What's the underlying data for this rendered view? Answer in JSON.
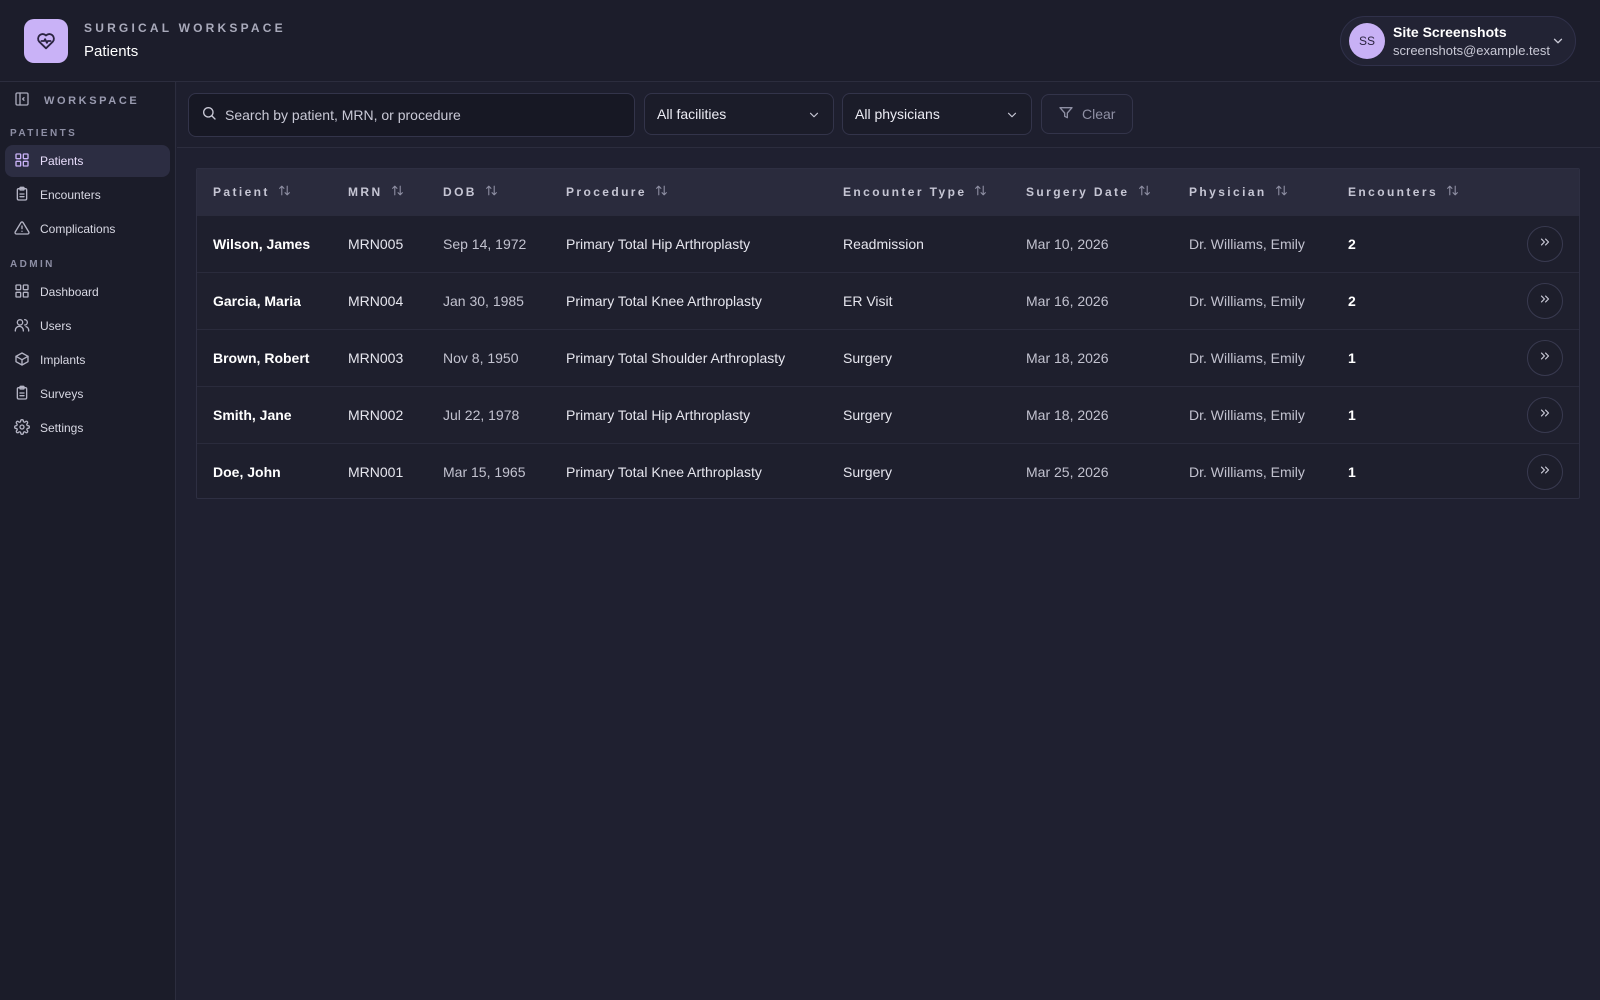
{
  "header": {
    "kicker": "SURGICAL WORKSPACE",
    "title": "Patients"
  },
  "user": {
    "initials": "SS",
    "name": "Site Screenshots",
    "email": "screenshots@example.test"
  },
  "sidebar": {
    "workspace_label": "WORKSPACE",
    "sections": [
      {
        "label": "PATIENTS",
        "items": [
          {
            "label": "Patients",
            "icon": "grid-icon",
            "active": true
          },
          {
            "label": "Encounters",
            "icon": "clipboard-icon",
            "active": false
          },
          {
            "label": "Complications",
            "icon": "warning-icon",
            "active": false
          }
        ]
      },
      {
        "label": "ADMIN",
        "items": [
          {
            "label": "Dashboard",
            "icon": "grid-icon",
            "active": false
          },
          {
            "label": "Users",
            "icon": "users-icon",
            "active": false
          },
          {
            "label": "Implants",
            "icon": "box-icon",
            "active": false
          },
          {
            "label": "Surveys",
            "icon": "clipboard-icon",
            "active": false
          },
          {
            "label": "Settings",
            "icon": "gear-icon",
            "active": false
          }
        ]
      }
    ]
  },
  "toolbar": {
    "search_placeholder": "Search by patient, MRN, or procedure",
    "facility_select": "All facilities",
    "physician_select": "All physicians",
    "clear_label": "Clear"
  },
  "table": {
    "columns": [
      "Patient",
      "MRN",
      "DOB",
      "Procedure",
      "Encounter Type",
      "Surgery Date",
      "Physician",
      "Encounters"
    ],
    "rows": [
      {
        "patient": "Wilson, James",
        "mrn": "MRN005",
        "dob": "Sep 14, 1972",
        "procedure": "Primary Total Hip Arthroplasty",
        "encounter_type": "Readmission",
        "surgery_date": "Mar 10, 2026",
        "physician": "Dr. Williams, Emily",
        "encounters": "2"
      },
      {
        "patient": "Garcia, Maria",
        "mrn": "MRN004",
        "dob": "Jan 30, 1985",
        "procedure": "Primary Total Knee Arthroplasty",
        "encounter_type": "ER Visit",
        "surgery_date": "Mar 16, 2026",
        "physician": "Dr. Williams, Emily",
        "encounters": "2"
      },
      {
        "patient": "Brown, Robert",
        "mrn": "MRN003",
        "dob": "Nov 8, 1950",
        "procedure": "Primary Total Shoulder Arthroplasty",
        "encounter_type": "Surgery",
        "surgery_date": "Mar 18, 2026",
        "physician": "Dr. Williams, Emily",
        "encounters": "1"
      },
      {
        "patient": "Smith, Jane",
        "mrn": "MRN002",
        "dob": "Jul 22, 1978",
        "procedure": "Primary Total Hip Arthroplasty",
        "encounter_type": "Surgery",
        "surgery_date": "Mar 18, 2026",
        "physician": "Dr. Williams, Emily",
        "encounters": "1"
      },
      {
        "patient": "Doe, John",
        "mrn": "MRN001",
        "dob": "Mar 15, 1965",
        "procedure": "Primary Total Knee Arthroplasty",
        "encounter_type": "Surgery",
        "surgery_date": "Mar 25, 2026",
        "physician": "Dr. Williams, Emily",
        "encounters": "1"
      }
    ]
  },
  "colors": {
    "accent": "#c9b2f7",
    "background": "#1f2030",
    "sidebar": "#1b1c29"
  }
}
